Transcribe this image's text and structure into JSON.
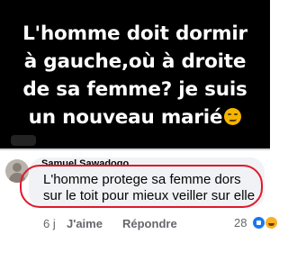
{
  "post": {
    "lines": [
      "L'homme doit dormir",
      "à gauche,où à droite",
      "de sa femme? je suis",
      "un nouveau marié"
    ],
    "emoji": "smirk-emoji"
  },
  "comment": {
    "author": "Samuel Sawadogo",
    "text": "L'homme protege sa femme dors sur le toit pour mieux veiller sur elle",
    "time": "6 j",
    "like_label": "J'aime",
    "reply_label": "Répondre",
    "reaction_count": "28",
    "reactions": [
      "like-icon",
      "haha-icon"
    ]
  },
  "colors": {
    "post_background": "#000000",
    "highlight_outline": "#e0192b",
    "bubble_background": "#f0f2f5"
  }
}
